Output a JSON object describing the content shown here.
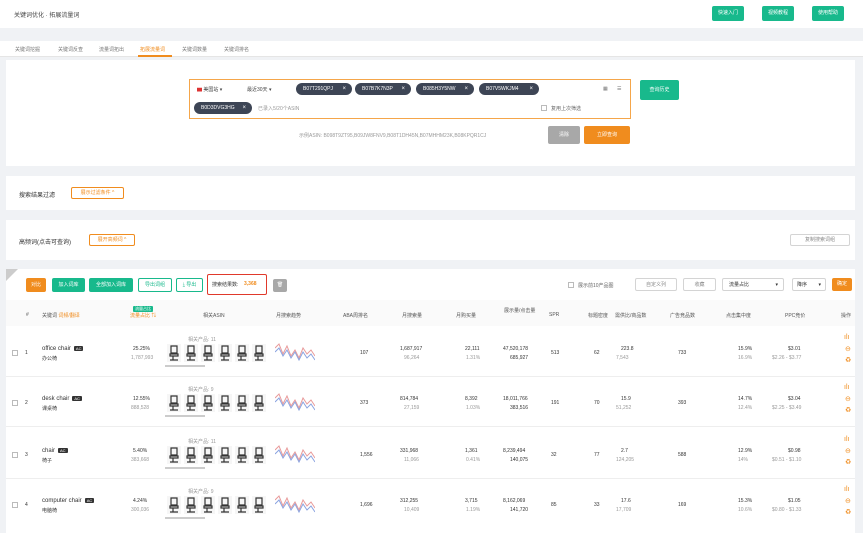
{
  "header": {
    "breadcrumb": "关键词优化 · 拓展流量词",
    "buttons": [
      "快速入门",
      "视频教程",
      "使用帮助"
    ]
  },
  "tabs": [
    "关键词挖掘",
    "关键词反查",
    "流量词拓出",
    "拓展流量词",
    "关键词数量",
    "关键词排名"
  ],
  "query": {
    "site": "美国站",
    "period": "最近30天",
    "asins": [
      "B07T291QPJ",
      "B07B7K7N3P",
      "B085H3Y5NW",
      "B07V5WKJM4",
      "B0D3DVG3HG"
    ],
    "count_hint": "已录入5/20个ASIN",
    "reuse_label": "复用上次筛选",
    "example": "示例ASIN: B098T9ZT95,B09JW8FNV9,B08T1DH45N,B07MHHM23K,B08KPQR1CJ",
    "history": "查询历史",
    "clear": "清除",
    "submit": "立即查询"
  },
  "filter": {
    "label": "搜索结果过滤",
    "btn": "展示过滤条件"
  },
  "freq": {
    "label": "高频词(点击可查询)",
    "btn": "展开高频词",
    "copy": "复制搜索词组"
  },
  "toolbar": {
    "compare": "对比",
    "add": "加入词库",
    "add_all": "全部加入词库",
    "export_word": "导出词组",
    "export": "导出",
    "count_label": "搜索结果数:",
    "count": "3,368",
    "top10": "展示前10产品图",
    "compare_btn": "自定义列",
    "collect": "收藏",
    "sort_field": "流量占比",
    "order": "降序",
    "confirm": "确定"
  },
  "columns": [
    "#",
    "关键词",
    "流量占比",
    "相关ASIN",
    "月搜索趋势",
    "ABA周排名",
    "月搜索量",
    "月购买量",
    "展示量/点击量",
    "SPR",
    "标题密度",
    "需供比/商品数",
    "广告竞品数",
    "点击集中度",
    "PPC竞价",
    "操作"
  ],
  "kw_sub": "词频/翻译",
  "share_tag": "流量占比",
  "rows": [
    {
      "n": "1",
      "kw": "office chair",
      "tr": "办公椅",
      "share": "25.25%",
      "share_sub": "1,787,993",
      "related": "相关产品: 11",
      "aba": "107",
      "ms": "1,687,917",
      "ms_sub": "96,264",
      "mp": "22,111",
      "mp_sub": "1.31%",
      "imp": "47,520,178",
      "clk": "685,927",
      "spr": "513",
      "td": "62",
      "sd": "223.8",
      "sd_sub": "7,543",
      "ad": "733",
      "cc": "15.9%",
      "cc_sub": "16.9%",
      "ppc": "$3.01",
      "ppc_sub": "$2.26 - $3.77"
    },
    {
      "n": "2",
      "kw": "desk chair",
      "tr": "课桌椅",
      "share": "12.55%",
      "share_sub": "888,528",
      "related": "相关产品: 9",
      "aba": "373",
      "ms": "814,784",
      "ms_sub": "27,159",
      "mp": "8,392",
      "mp_sub": "1.03%",
      "imp": "18,011,766",
      "clk": "383,516",
      "spr": "191",
      "td": "70",
      "sd": "15.9",
      "sd_sub": "51,252",
      "ad": "393",
      "cc": "14.7%",
      "cc_sub": "12.4%",
      "ppc": "$3.04",
      "ppc_sub": "$2.25 - $3.49"
    },
    {
      "n": "3",
      "kw": "chair",
      "tr": "椅子",
      "share": "5.40%",
      "share_sub": "383,668",
      "related": "相关产品: 11",
      "aba": "1,556",
      "ms": "331,968",
      "ms_sub": "11,066",
      "mp": "1,361",
      "mp_sub": "0.41%",
      "imp": "8,239,494",
      "clk": "140,075",
      "spr": "32",
      "td": "77",
      "sd": "2.7",
      "sd_sub": "124,205",
      "ad": "588",
      "cc": "12.9%",
      "cc_sub": "14%",
      "ppc": "$0.98",
      "ppc_sub": "$0.51 - $1.10"
    },
    {
      "n": "4",
      "kw": "computer chair",
      "tr": "电脑椅",
      "share": "4.24%",
      "share_sub": "300,036",
      "related": "相关产品: 9",
      "aba": "1,696",
      "ms": "312,255",
      "ms_sub": "10,409",
      "mp": "3,715",
      "mp_sub": "1.19%",
      "imp": "8,162,069",
      "clk": "141,720",
      "spr": "85",
      "td": "33",
      "sd": "17.6",
      "sd_sub": "17,709",
      "ad": "169",
      "cc": "15.3%",
      "cc_sub": "10.6%",
      "ppc": "$1.05",
      "ppc_sub": "$0.80 - $1.33"
    }
  ],
  "colors": {
    "accent": "#f08c1e",
    "green": "#18b98c",
    "chip": "#3d4555"
  }
}
